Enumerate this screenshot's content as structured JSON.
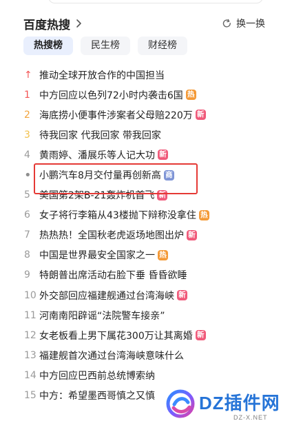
{
  "header": {
    "title": "百度热搜",
    "chevron_icon": "chevron-right-icon",
    "refresh_label": "换一换",
    "refresh_icon": "refresh-icon"
  },
  "tabs": [
    {
      "label": "热搜榜",
      "active": true
    },
    {
      "label": "民生榜",
      "active": false
    },
    {
      "label": "财经榜",
      "active": false
    }
  ],
  "items": [
    {
      "rank": "↑",
      "rank_icon": "top-arrow-icon",
      "title": "推动全球开放合作的中国担当",
      "badge": ""
    },
    {
      "rank": "1",
      "title": "中方回应以色列72小时内袭击6国",
      "badge": "热"
    },
    {
      "rank": "2",
      "title": "海底捞小便事件涉案者父母赔220万",
      "badge": "新"
    },
    {
      "rank": "3",
      "title": "待我回家 代我回家 带我回家",
      "badge": ""
    },
    {
      "rank": "4",
      "title": "黄雨婷、潘展乐等人记大功",
      "badge": "新"
    },
    {
      "rank": "•",
      "title": "小鹏汽车8月交付量再创新高",
      "badge": "商"
    },
    {
      "rank": "5",
      "title": "美国第2架B-21轰炸机首飞",
      "badge": "新"
    },
    {
      "rank": "6",
      "title": "女子将行李箱从43楼抛下辩称没拿住",
      "badge": "热"
    },
    {
      "rank": "7",
      "title": "热热热！全国秋老虎返场地图出炉",
      "badge": "新"
    },
    {
      "rank": "8",
      "title": "中国是世界最安全国家之一",
      "badge": "热"
    },
    {
      "rank": "9",
      "title": "特朗普出席活动右脸下垂 昏昏欲睡",
      "badge": ""
    },
    {
      "rank": "10",
      "title": "外交部回应福建舰通过台湾海峡",
      "badge": "新"
    },
    {
      "rank": "11",
      "title": "河南南阳辟谣“法院警车接亲”",
      "badge": ""
    },
    {
      "rank": "12",
      "title": "女老板看上男下属花300万让其离婚",
      "badge": "新"
    },
    {
      "rank": "13",
      "title": "福建舰首次通过台湾海峡意味什么",
      "badge": ""
    },
    {
      "rank": "14",
      "title": "中方回应巴西前总统博索纳",
      "badge": ""
    },
    {
      "rank": "15",
      "title": "中方：希望墨西哥慎之又慎",
      "badge": ""
    }
  ],
  "watermark": {
    "brand": "DZ插件网",
    "domain": "DZ-X.NET",
    "logo_icon": "dz-plugin-logo-icon"
  },
  "colors": {
    "highlight": "#e53935",
    "hot_badge": "#f49a38",
    "new_badge": "#f05a7a",
    "ad_badge": "#7f95d6"
  }
}
